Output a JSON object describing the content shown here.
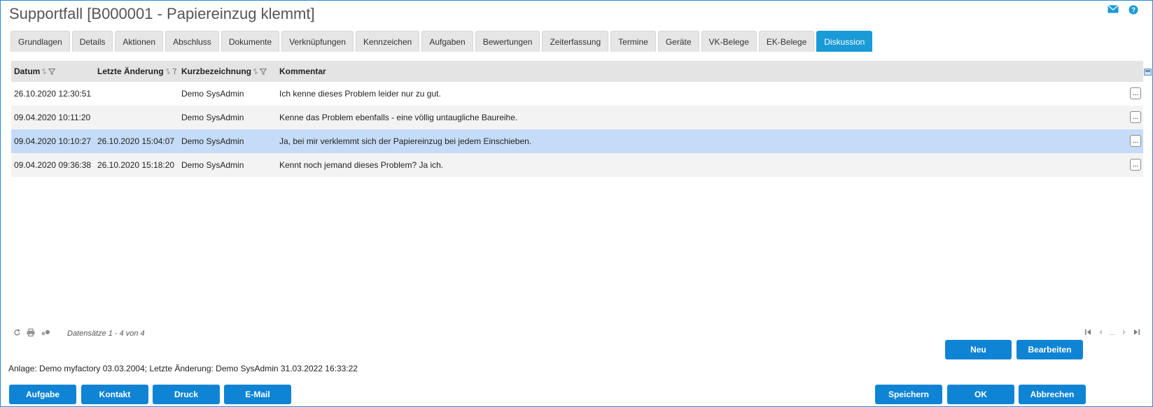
{
  "window": {
    "title": "Supportfall [B000001 - Papiereinzug klemmt]"
  },
  "header_icons": [
    {
      "name": "mail-icon"
    },
    {
      "name": "help-icon"
    }
  ],
  "tabs": [
    {
      "label": "Grundlagen",
      "active": false
    },
    {
      "label": "Details",
      "active": false
    },
    {
      "label": "Aktionen",
      "active": false
    },
    {
      "label": "Abschluss",
      "active": false
    },
    {
      "label": "Dokumente",
      "active": false
    },
    {
      "label": "Verknüpfungen",
      "active": false
    },
    {
      "label": "Kennzeichen",
      "active": false
    },
    {
      "label": "Aufgaben",
      "active": false
    },
    {
      "label": "Bewertungen",
      "active": false
    },
    {
      "label": "Zeiterfassung",
      "active": false
    },
    {
      "label": "Termine",
      "active": false
    },
    {
      "label": "Geräte",
      "active": false
    },
    {
      "label": "VK-Belege",
      "active": false
    },
    {
      "label": "EK-Belege",
      "active": false
    },
    {
      "label": "Diskussion",
      "active": true
    }
  ],
  "grid": {
    "columns": [
      "Datum",
      "Letzte Änderung",
      "Kurzbezeichnung",
      "Kommentar"
    ],
    "rows": [
      {
        "datum": "26.10.2020 12:30:51",
        "letzte_aenderung": "",
        "kurzbezeichnung": "Demo SysAdmin",
        "kommentar": "Ich kenne dieses Problem leider nur zu gut.",
        "selected": false
      },
      {
        "datum": "09.04.2020 10:11:20",
        "letzte_aenderung": "",
        "kurzbezeichnung": "Demo SysAdmin",
        "kommentar": "Kenne das Problem ebenfalls - eine völlig untaugliche Baureihe.",
        "selected": false
      },
      {
        "datum": "09.04.2020 10:10:27",
        "letzte_aenderung": "26.10.2020 15:04:07",
        "kurzbezeichnung": "Demo SysAdmin",
        "kommentar": "Ja, bei mir verklemmt sich der Papiereinzug bei jedem Einschieben.",
        "selected": true
      },
      {
        "datum": "09.04.2020 09:36:38",
        "letzte_aenderung": "26.10.2020 15:18:20",
        "kurzbezeichnung": "Demo SysAdmin",
        "kommentar": "Kennt noch jemand dieses Problem? Ja ich.",
        "selected": false
      }
    ],
    "row_button_label": "...",
    "records_text": "Datensätze 1 - 4 von 4",
    "pager_ellipsis": "..."
  },
  "grid_buttons": {
    "new": "Neu",
    "edit": "Bearbeiten"
  },
  "info_line": "Anlage: Demo myfactory 03.03.2004; Letzte Änderung: Demo SysAdmin 31.03.2022 16:33:22",
  "footer_buttons": {
    "task": "Aufgabe",
    "contact": "Kontakt",
    "print": "Druck",
    "email": "E-Mail",
    "save": "Speichern",
    "ok": "OK",
    "cancel": "Abbrechen"
  },
  "colors": {
    "accent": "#0f84d4",
    "active_tab": "#1a9ad6",
    "selected_row": "#c5dcf8"
  }
}
